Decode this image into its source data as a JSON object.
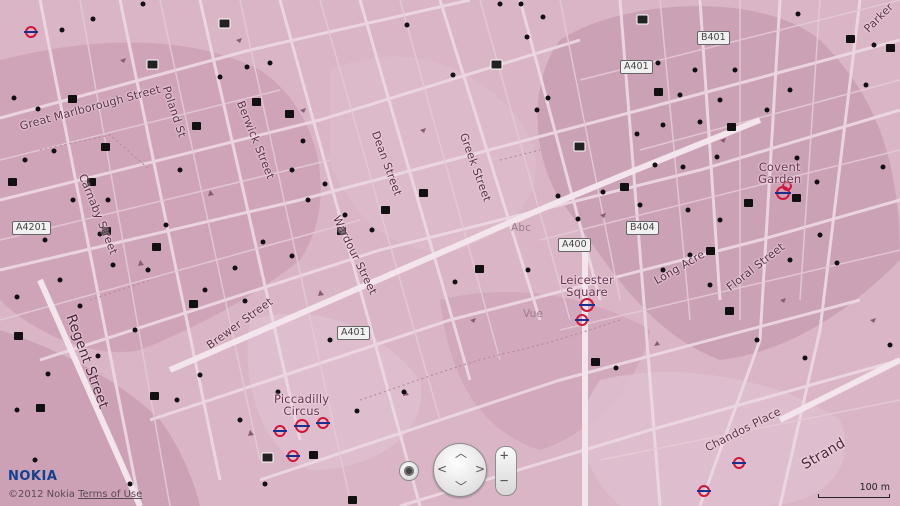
{
  "map": {
    "streets": [
      {
        "name": "Great Marlborough Street"
      },
      {
        "name": "Poland St"
      },
      {
        "name": "Berwick Street"
      },
      {
        "name": "Dean Street"
      },
      {
        "name": "Greek Street"
      },
      {
        "name": "Carnaby Street"
      },
      {
        "name": "Wardour Street"
      },
      {
        "name": "Brewer Street"
      },
      {
        "name": "Regent Street"
      },
      {
        "name": "Long Acre"
      },
      {
        "name": "Floral Street"
      },
      {
        "name": "Chandos Place"
      },
      {
        "name": "Strand"
      },
      {
        "name": "Parker"
      }
    ],
    "places": [
      {
        "name": "Covent\nGarden"
      },
      {
        "name": "Leicester\nSquare"
      },
      {
        "name": "Piccadilly\nCircus"
      }
    ],
    "pois": [
      {
        "name": "Abc"
      },
      {
        "name": "Vue"
      }
    ],
    "road_shields": [
      "A401",
      "B401",
      "A4201",
      "A400",
      "B404",
      "A401"
    ],
    "brand": "NOKIA",
    "copyright": "©2012 Nokia",
    "terms": "Terms of Use",
    "scale_label": "100 m",
    "colors": {
      "base": "#d9b5c6",
      "dark_area": "#c79bb1",
      "road": "#ecd6e1",
      "major_road": "#f4e6ed",
      "text": "#5c2f46"
    },
    "icons": [
      "underground-icon",
      "shopping-bag-icon",
      "cinema-icon",
      "poi-dot-icon",
      "locate-icon",
      "pan-control",
      "zoom-control"
    ]
  }
}
